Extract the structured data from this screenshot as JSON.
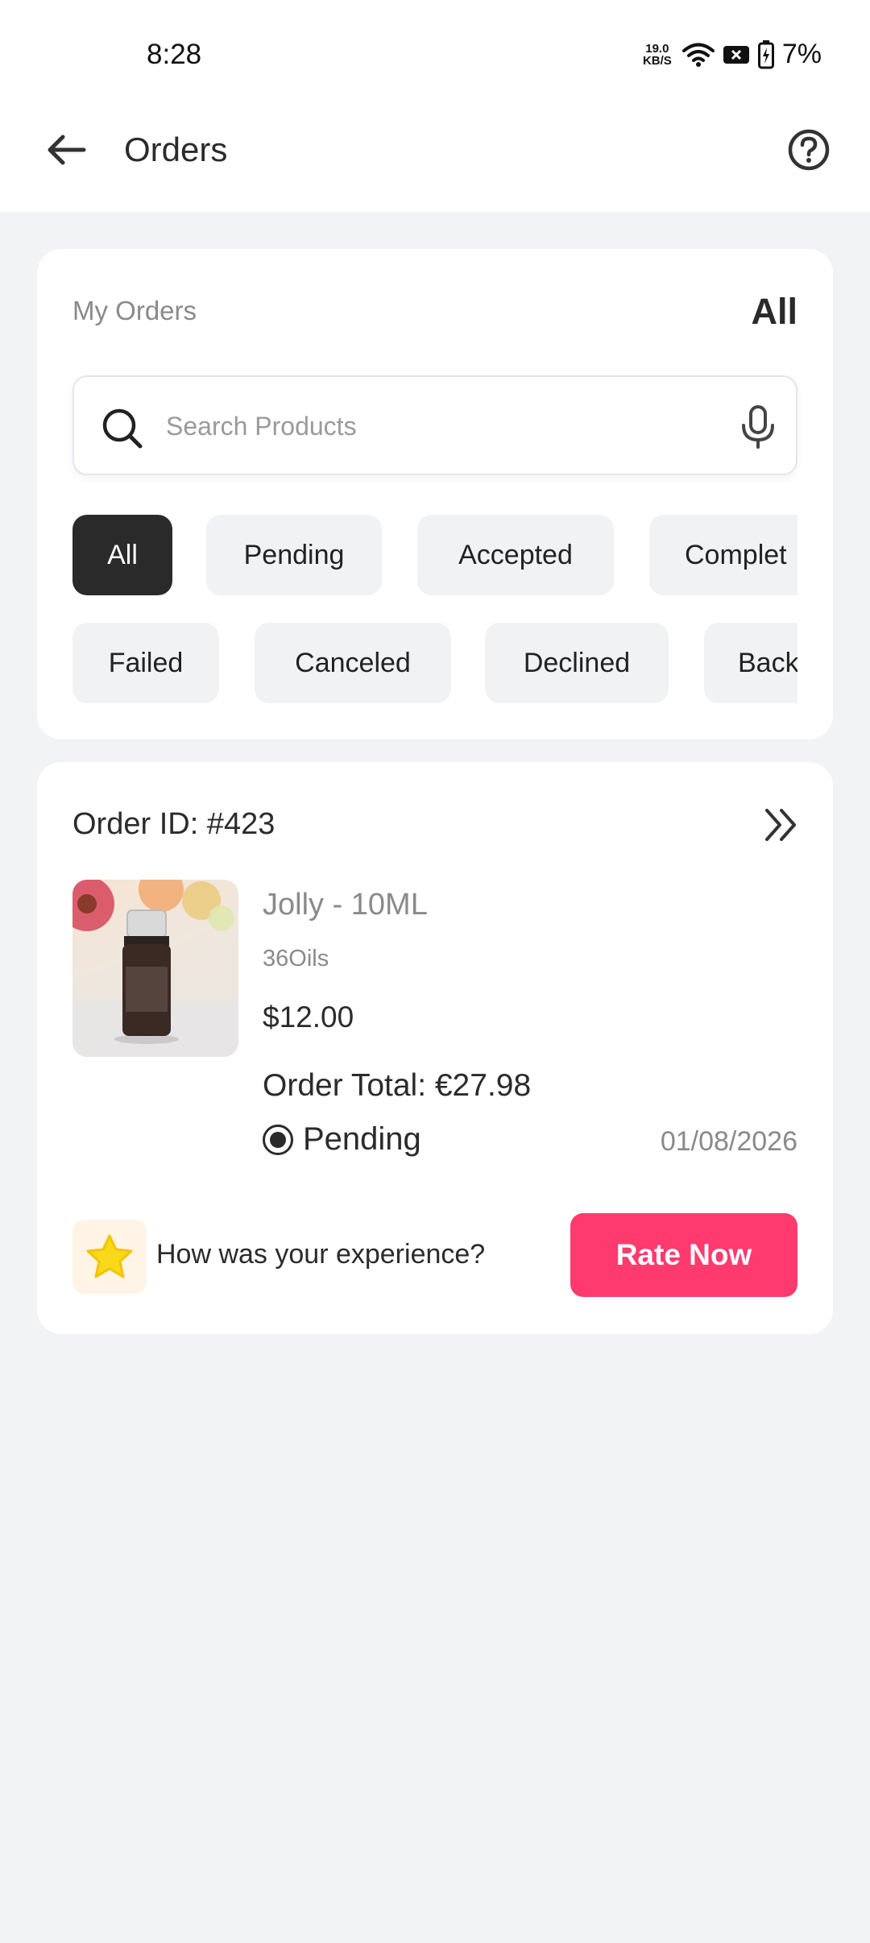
{
  "status_bar": {
    "time": "8:28",
    "net_speed_value": "19.0",
    "net_speed_unit": "KB/S",
    "battery": "7%"
  },
  "app_bar": {
    "title": "Orders",
    "back_icon": "arrow-left-icon",
    "help_icon": "question-circle-icon"
  },
  "filters": {
    "section_label": "My Orders",
    "current_filter": "All",
    "search": {
      "placeholder": "Search Products",
      "value": ""
    },
    "chips_row1": [
      "All",
      "Pending",
      "Accepted",
      "Complet"
    ],
    "chips_row2": [
      "Failed",
      "Canceled",
      "Declined",
      "Back"
    ],
    "active_chip": "All"
  },
  "order": {
    "id_label": "Order ID: #423",
    "product_name": "Jolly - 10ML",
    "brand": "36Oils",
    "price": "$12.00",
    "total": "Order Total: €27.98",
    "status": "Pending",
    "date": "01/08/2026",
    "rate_question": "How was your experience?",
    "rate_button": "Rate Now"
  },
  "colors": {
    "accent": "#ff3a6e",
    "chip_active_bg": "#2a2a2a",
    "chip_bg": "#f1f2f4",
    "page_bg": "#f2f3f5",
    "star": "#f7d81a"
  }
}
